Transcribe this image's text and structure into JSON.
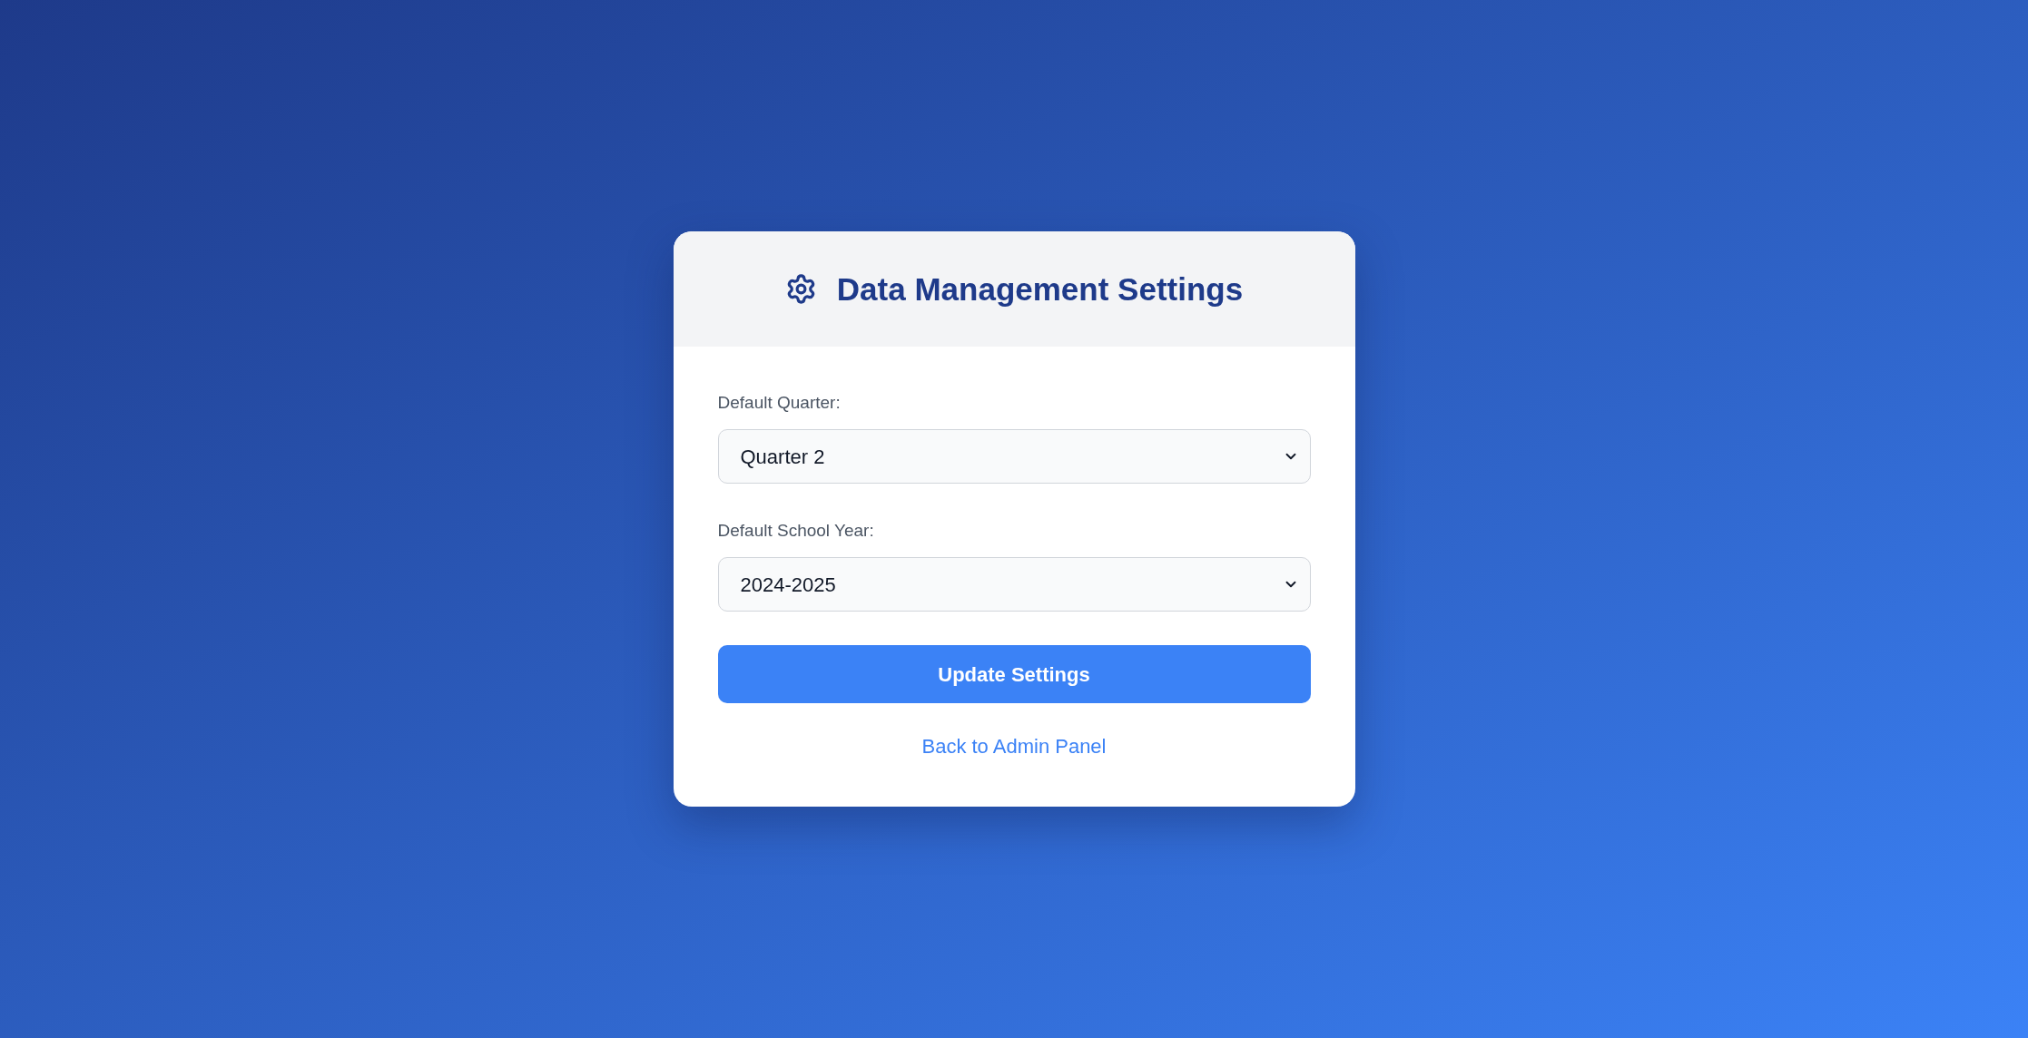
{
  "header": {
    "title": "Data Management Settings"
  },
  "fields": [
    {
      "label": "Default Quarter:",
      "value": "Quarter 2"
    },
    {
      "label": "Default School Year:",
      "value": "2024-2025"
    }
  ],
  "submit_button": {
    "label": "Update Settings"
  },
  "back_link": {
    "label": "Back to Admin Panel"
  }
}
